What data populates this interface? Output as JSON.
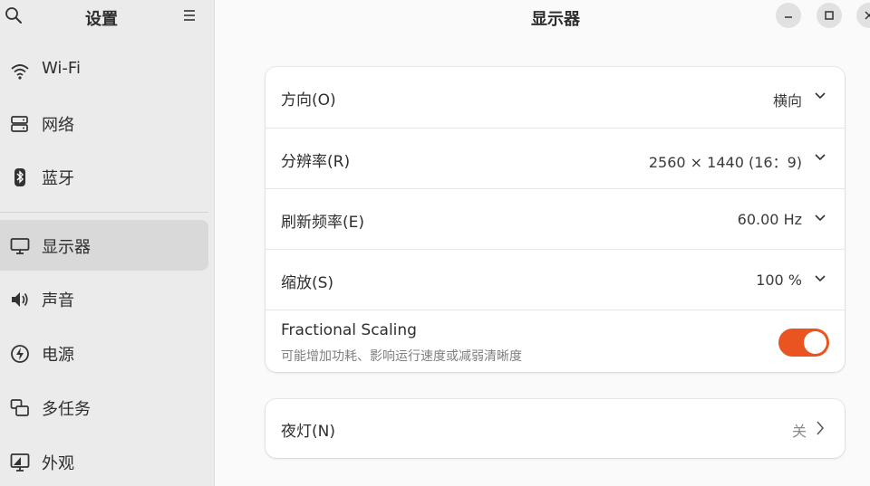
{
  "sidebar": {
    "title": "设置",
    "items": [
      {
        "label": "Wi-Fi",
        "icon": "wifi-icon"
      },
      {
        "label": "网络",
        "icon": "network-icon"
      },
      {
        "label": "蓝牙",
        "icon": "bluetooth-icon"
      },
      {
        "label": "显示器",
        "icon": "display-icon",
        "active": true
      },
      {
        "label": "声音",
        "icon": "sound-icon"
      },
      {
        "label": "电源",
        "icon": "power-icon"
      },
      {
        "label": "多任务",
        "icon": "multitasking-icon"
      },
      {
        "label": "外观",
        "icon": "appearance-icon"
      }
    ]
  },
  "main": {
    "title": "显示器",
    "settings": {
      "orientation": {
        "label": "方向(O)",
        "value": "横向"
      },
      "resolution": {
        "label": "分辨率(R)",
        "value": "2560 × 1440 (16：9)"
      },
      "refresh": {
        "label": "刷新频率(E)",
        "value": "60.00 Hz"
      },
      "scale": {
        "label": "缩放(S)",
        "value": "100 %"
      },
      "fractional": {
        "label": "Fractional Scaling",
        "sublabel": "可能增加功耗、影响运行速度或减弱清晰度",
        "enabled": true
      }
    },
    "night_light": {
      "label": "夜灯(N)",
      "value": "关"
    }
  },
  "colors": {
    "accent": "#e95420",
    "sidebar_bg": "#ebebeb",
    "active_item": "#d9d9d9"
  }
}
